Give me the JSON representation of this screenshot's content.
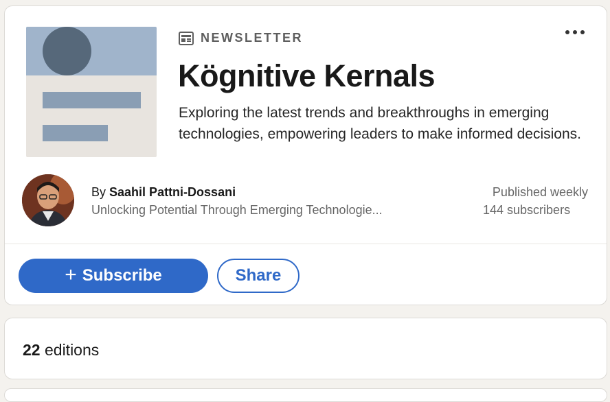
{
  "newsletter": {
    "type_label": "NEWSLETTER",
    "title": "Kögnitive Kernals",
    "description": "Exploring the latest trends and breakthroughs in emerging technologies, empowering leaders to make informed decisions.",
    "more_icon": "more-horizontal-icon",
    "type_icon": "newsletter-icon"
  },
  "author": {
    "by_prefix": "By",
    "name": "Saahil Pattni-Dossani",
    "tagline": "Unlocking Potential Through Emerging Technologie..."
  },
  "stats": {
    "frequency": "Published weekly",
    "subscribers": "144 subscribers"
  },
  "actions": {
    "subscribe_icon": "plus-icon",
    "subscribe_label": "Subscribe",
    "share_label": "Share"
  },
  "editions": {
    "count": "22",
    "label": "editions"
  },
  "colors": {
    "accent": "#2f69c8",
    "page_bg": "#f4f2ee",
    "muted_text": "#666666"
  }
}
